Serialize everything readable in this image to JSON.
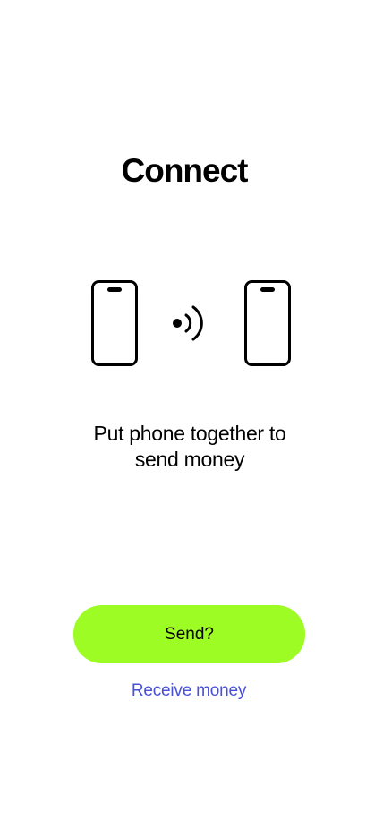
{
  "screen": {
    "title": "Connect",
    "instruction_line1": "Put phone together to",
    "instruction_line2": "send money"
  },
  "icons": {
    "left_phone": "smartphone-icon",
    "signal": "contactless-signal-icon",
    "right_phone": "smartphone-icon"
  },
  "actions": {
    "send_label": "Send?",
    "receive_label": "Receive money"
  },
  "colors": {
    "accent": "#9efc25",
    "link": "#4a4fd6",
    "text": "#000000",
    "background": "#ffffff"
  }
}
